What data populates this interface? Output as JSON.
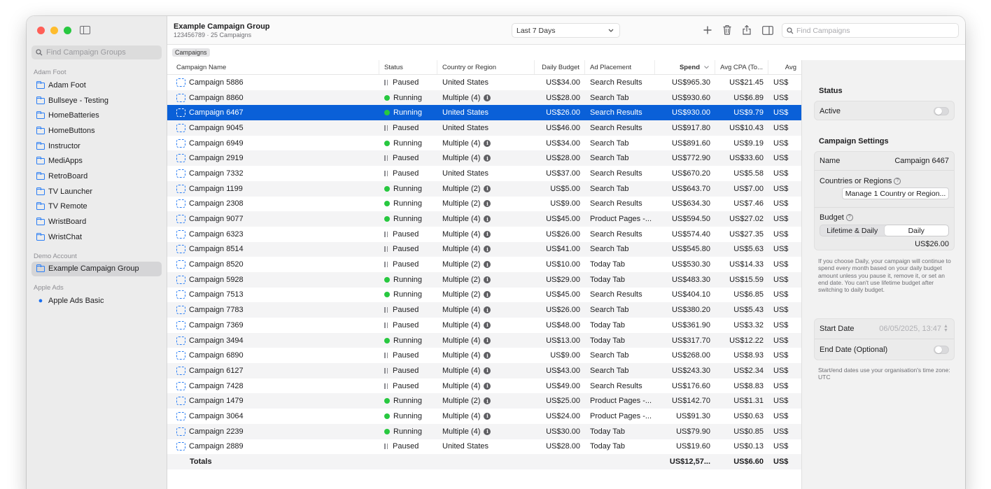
{
  "sidebar": {
    "search_placeholder": "Find Campaign Groups",
    "sections": [
      {
        "title": "Adam Foot",
        "items": [
          "Adam Foot",
          "Bullseye - Testing",
          "HomeBatteries",
          "HomeButtons",
          "Instructor",
          "MediApps",
          "RetroBoard",
          "TV Launcher",
          "TV Remote",
          "WristBoard",
          "WristChat"
        ]
      },
      {
        "title": "Demo Account",
        "items": [
          "Example Campaign Group"
        ]
      },
      {
        "title": "Apple Ads",
        "items": [
          "Apple Ads Basic"
        ]
      }
    ],
    "selected": "Example Campaign Group"
  },
  "toolbar": {
    "title": "Example Campaign Group",
    "subtitle": "123456789 · 25 Campaigns",
    "date_range": "Last 7 Days",
    "search_placeholder": "Find Campaigns",
    "breadcrumb": "Campaigns"
  },
  "table": {
    "columns": [
      "Campaign Name",
      "Status",
      "Country or Region",
      "Daily Budget",
      "Ad Placement",
      "Spend",
      "Avg CPA (To...",
      "Avg"
    ],
    "sort_column": "Spend",
    "rows": [
      [
        "Campaign 5886",
        "Paused",
        "United States",
        "US$34.00",
        "Search Results",
        "US$965.30",
        "US$21.45",
        "US$"
      ],
      [
        "Campaign 8860",
        "Running",
        "Multiple (4)",
        "US$28.00",
        "Search Tab",
        "US$930.60",
        "US$6.89",
        "US$"
      ],
      [
        "Campaign 6467",
        "Running",
        "United States",
        "US$26.00",
        "Search Results",
        "US$930.00",
        "US$9.79",
        "US$"
      ],
      [
        "Campaign 9045",
        "Paused",
        "United States",
        "US$46.00",
        "Search Results",
        "US$917.80",
        "US$10.43",
        "US$"
      ],
      [
        "Campaign 6949",
        "Running",
        "Multiple (4)",
        "US$34.00",
        "Search Tab",
        "US$891.60",
        "US$9.19",
        "US$"
      ],
      [
        "Campaign 2919",
        "Paused",
        "Multiple (4)",
        "US$28.00",
        "Search Tab",
        "US$772.90",
        "US$33.60",
        "US$"
      ],
      [
        "Campaign 7332",
        "Paused",
        "United States",
        "US$37.00",
        "Search Results",
        "US$670.20",
        "US$5.58",
        "US$"
      ],
      [
        "Campaign 1199",
        "Running",
        "Multiple (2)",
        "US$5.00",
        "Search Tab",
        "US$643.70",
        "US$7.00",
        "US$"
      ],
      [
        "Campaign 2308",
        "Running",
        "Multiple (2)",
        "US$9.00",
        "Search Results",
        "US$634.30",
        "US$7.46",
        "US$"
      ],
      [
        "Campaign 9077",
        "Running",
        "Multiple (4)",
        "US$45.00",
        "Product Pages -...",
        "US$594.50",
        "US$27.02",
        "US$"
      ],
      [
        "Campaign 6323",
        "Paused",
        "Multiple (4)",
        "US$26.00",
        "Search Results",
        "US$574.40",
        "US$27.35",
        "US$"
      ],
      [
        "Campaign 8514",
        "Paused",
        "Multiple (4)",
        "US$41.00",
        "Search Tab",
        "US$545.80",
        "US$5.63",
        "US$"
      ],
      [
        "Campaign 8520",
        "Paused",
        "Multiple (2)",
        "US$10.00",
        "Today Tab",
        "US$530.30",
        "US$14.33",
        "US$"
      ],
      [
        "Campaign 5928",
        "Running",
        "Multiple (2)",
        "US$29.00",
        "Today Tab",
        "US$483.30",
        "US$15.59",
        "US$"
      ],
      [
        "Campaign 7513",
        "Running",
        "Multiple (2)",
        "US$45.00",
        "Search Results",
        "US$404.10",
        "US$6.85",
        "US$"
      ],
      [
        "Campaign 7783",
        "Paused",
        "Multiple (4)",
        "US$26.00",
        "Search Tab",
        "US$380.20",
        "US$5.43",
        "US$"
      ],
      [
        "Campaign 7369",
        "Paused",
        "Multiple (4)",
        "US$48.00",
        "Today Tab",
        "US$361.90",
        "US$3.32",
        "US$"
      ],
      [
        "Campaign 3494",
        "Running",
        "Multiple (4)",
        "US$13.00",
        "Today Tab",
        "US$317.70",
        "US$12.22",
        "US$"
      ],
      [
        "Campaign 6890",
        "Paused",
        "Multiple (4)",
        "US$9.00",
        "Search Tab",
        "US$268.00",
        "US$8.93",
        "US$"
      ],
      [
        "Campaign 6127",
        "Paused",
        "Multiple (4)",
        "US$43.00",
        "Search Tab",
        "US$243.30",
        "US$2.34",
        "US$"
      ],
      [
        "Campaign 7428",
        "Paused",
        "Multiple (4)",
        "US$49.00",
        "Search Results",
        "US$176.60",
        "US$8.83",
        "US$"
      ],
      [
        "Campaign 1479",
        "Running",
        "Multiple (2)",
        "US$25.00",
        "Product Pages -...",
        "US$142.70",
        "US$1.31",
        "US$"
      ],
      [
        "Campaign 3064",
        "Running",
        "Multiple (4)",
        "US$24.00",
        "Product Pages -...",
        "US$91.30",
        "US$0.63",
        "US$"
      ],
      [
        "Campaign 2239",
        "Running",
        "Multiple (4)",
        "US$30.00",
        "Today Tab",
        "US$79.90",
        "US$0.85",
        "US$"
      ],
      [
        "Campaign 2889",
        "Paused",
        "United States",
        "US$28.00",
        "Today Tab",
        "US$19.60",
        "US$0.13",
        "US$"
      ]
    ],
    "selected_row": 2,
    "totals": {
      "label": "Totals",
      "spend": "US$12,57...",
      "cpa": "US$6.60",
      "more": "US$"
    }
  },
  "inspector": {
    "status_heading": "Status",
    "active_label": "Active",
    "settings_heading": "Campaign Settings",
    "name_label": "Name",
    "name_value": "Campaign 6467",
    "countries_label": "Countries or Regions",
    "manage_button": "Manage 1 Country or Region...",
    "budget_label": "Budget",
    "budget_options": [
      "Lifetime & Daily",
      "Daily"
    ],
    "budget_selected": "Daily",
    "budget_value": "US$26.00",
    "budget_note": "If you choose Daily, your campaign will continue to spend every month based on your daily budget amount unless you pause it, remove it, or set an end date. You can't use lifetime budget after switching to daily budget.",
    "start_date_label": "Start Date",
    "start_date_value": "06/05/2025, 13:47",
    "end_date_label": "End Date (Optional)",
    "date_note": "Start/end dates use your organisation's time zone: UTC"
  },
  "colors": {
    "accent": "#0a60d8",
    "running": "#28c840",
    "folder": "#2a7ef5"
  }
}
